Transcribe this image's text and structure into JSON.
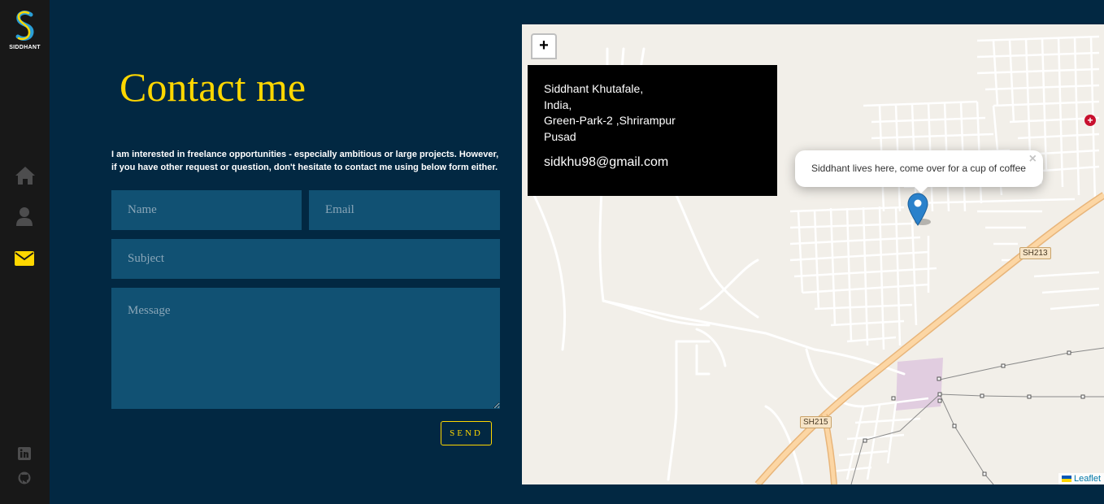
{
  "sidebar": {
    "logo_letter": "S",
    "logo_text": "SIDDHANT",
    "nav": [
      {
        "icon": "home-icon"
      },
      {
        "icon": "user-icon"
      },
      {
        "icon": "envelope-icon",
        "active": true
      }
    ],
    "social": [
      {
        "icon": "linkedin-icon"
      },
      {
        "icon": "github-icon"
      }
    ],
    "colors": {
      "active": "#ffd700",
      "inactive": "#4d4d4e"
    }
  },
  "contact": {
    "title": "Contact me",
    "intro": "I am interested in freelance opportunities - especially ambitious or large projects. However, if you have other request or question, don't hesitate to contact me using below form either.",
    "form": {
      "name_placeholder": "Name",
      "email_placeholder": "Email",
      "subject_placeholder": "Subject",
      "message_placeholder": "Message",
      "send_label": "SEND"
    }
  },
  "map": {
    "zoom_in_label": "+",
    "info": {
      "name": "Siddhant Khutafale,",
      "country": "India,",
      "address": "Green-Park-2 ,Shrirampur",
      "city": "Pusad",
      "email": "sidkhu98@gmail.com"
    },
    "popup_text": "Siddhant lives here, come over for a cup of coffee",
    "popup_close": "×",
    "road_labels": [
      "SH213",
      "SH215"
    ],
    "poi_symbol": "+",
    "attribution": "Leaflet"
  },
  "colors": {
    "background": "#022842",
    "accent": "#ffd700",
    "field": "#115173",
    "sidebar": "#181818"
  }
}
